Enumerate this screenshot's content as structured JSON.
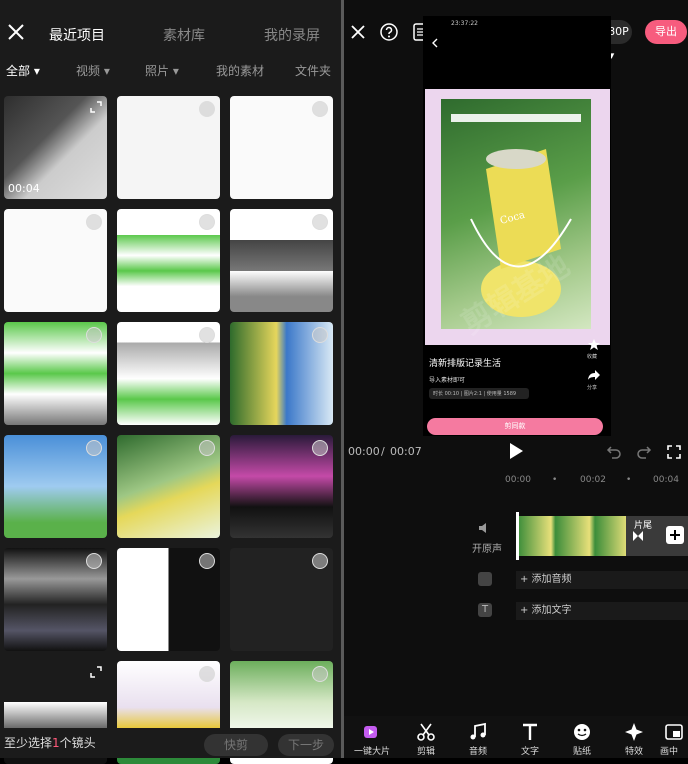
{
  "left": {
    "tabs": [
      "最近项目",
      "素材库",
      "我的录屏"
    ],
    "filters": [
      "全部",
      "视频",
      "照片",
      "我的素材",
      "文件夹"
    ],
    "grid_items": [
      {
        "kind": "video",
        "duration": "00:04"
      },
      {
        "kind": "image"
      },
      {
        "kind": "image"
      },
      {
        "kind": "image"
      },
      {
        "kind": "image"
      },
      {
        "kind": "image"
      },
      {
        "kind": "image"
      },
      {
        "kind": "image"
      },
      {
        "kind": "image"
      },
      {
        "kind": "image"
      },
      {
        "kind": "image"
      },
      {
        "kind": "image"
      },
      {
        "kind": "image"
      },
      {
        "kind": "image"
      },
      {
        "kind": "image"
      },
      {
        "kind": "image"
      },
      {
        "kind": "image"
      },
      {
        "kind": "image"
      }
    ],
    "hint_prefix": "至少选择",
    "hint_num": "1",
    "hint_suffix": "个镜头",
    "btn_quick_cut": "快剪",
    "btn_next": "下一步"
  },
  "right": {
    "resolution": "1080P",
    "export": "导出",
    "phone_time": "23:37:22",
    "preview_title": "清新排版记录生活",
    "preview_sub": "导入素材即可",
    "preview_meta": "时长 00:10 | 图片2:1 | 使用量 1589",
    "use_btn": "剪同款",
    "side_fav": "收藏",
    "side_share": "分享",
    "time_current": "00:00",
    "time_sep": "/",
    "time_total": "00:07",
    "ruler": [
      "00:00",
      "00:02",
      "00:04"
    ],
    "original_sound": "开原声",
    "tail_label": "片尾",
    "add_audio": "+ 添加音频",
    "add_text": "+ 添加文字",
    "tools": [
      "一键大片",
      "剪辑",
      "音频",
      "文字",
      "贴纸",
      "特效",
      "画中"
    ]
  },
  "colors": {
    "accent": "#f75c7e"
  }
}
